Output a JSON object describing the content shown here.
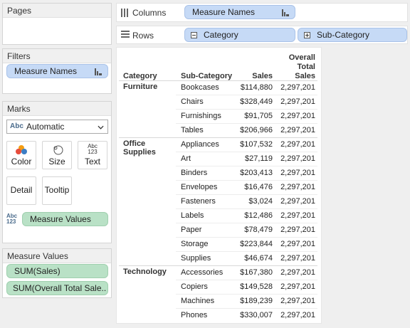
{
  "pages": {
    "title": "Pages"
  },
  "filters": {
    "title": "Filters",
    "pill": "Measure Names"
  },
  "marks": {
    "title": "Marks",
    "type_icon": "Abc",
    "type": "Automatic",
    "buttons": [
      {
        "label": "Color",
        "icon": "color-icon"
      },
      {
        "label": "Size",
        "icon": "size-icon"
      },
      {
        "label": "Text",
        "icon": "text-icon"
      },
      {
        "label": "Detail",
        "icon": "detail-icon"
      },
      {
        "label": "Tooltip",
        "icon": "tooltip-icon"
      }
    ],
    "text_icon": "Abc 123",
    "measure_values_pill": "Measure Values"
  },
  "measure_values": {
    "title": "Measure Values",
    "items": [
      "SUM(Sales)",
      "SUM(Overall Total Sale.."
    ]
  },
  "columns": {
    "label": "Columns",
    "pill": "Measure Names"
  },
  "rows": {
    "label": "Rows",
    "pills": [
      "Category",
      "Sub-Category"
    ]
  },
  "table": {
    "headers": {
      "category": "Category",
      "subcategory": "Sub-Category",
      "sales": "Sales",
      "overall": [
        "Overall",
        "Total",
        "Sales"
      ]
    },
    "groups": [
      {
        "category": [
          "Furniture"
        ],
        "rows": [
          {
            "sub": "Bookcases",
            "sales": "$114,880",
            "total": "2,297,201"
          },
          {
            "sub": "Chairs",
            "sales": "$328,449",
            "total": "2,297,201"
          },
          {
            "sub": "Furnishings",
            "sales": "$91,705",
            "total": "2,297,201"
          },
          {
            "sub": "Tables",
            "sales": "$206,966",
            "total": "2,297,201"
          }
        ]
      },
      {
        "category": [
          "Office",
          "Supplies"
        ],
        "rows": [
          {
            "sub": "Appliances",
            "sales": "$107,532",
            "total": "2,297,201"
          },
          {
            "sub": "Art",
            "sales": "$27,119",
            "total": "2,297,201"
          },
          {
            "sub": "Binders",
            "sales": "$203,413",
            "total": "2,297,201"
          },
          {
            "sub": "Envelopes",
            "sales": "$16,476",
            "total": "2,297,201"
          },
          {
            "sub": "Fasteners",
            "sales": "$3,024",
            "total": "2,297,201"
          },
          {
            "sub": "Labels",
            "sales": "$12,486",
            "total": "2,297,201"
          },
          {
            "sub": "Paper",
            "sales": "$78,479",
            "total": "2,297,201"
          },
          {
            "sub": "Storage",
            "sales": "$223,844",
            "total": "2,297,201"
          },
          {
            "sub": "Supplies",
            "sales": "$46,674",
            "total": "2,297,201"
          }
        ]
      },
      {
        "category": [
          "Technology"
        ],
        "rows": [
          {
            "sub": "Accessories",
            "sales": "$167,380",
            "total": "2,297,201"
          },
          {
            "sub": "Copiers",
            "sales": "$149,528",
            "total": "2,297,201"
          },
          {
            "sub": "Machines",
            "sales": "$189,239",
            "total": "2,297,201"
          },
          {
            "sub": "Phones",
            "sales": "$330,007",
            "total": "2,297,201"
          }
        ]
      }
    ]
  },
  "colors": {
    "blue_pill": "#c6daf6",
    "green_pill": "#b9e1c6",
    "background": "#efefef"
  }
}
